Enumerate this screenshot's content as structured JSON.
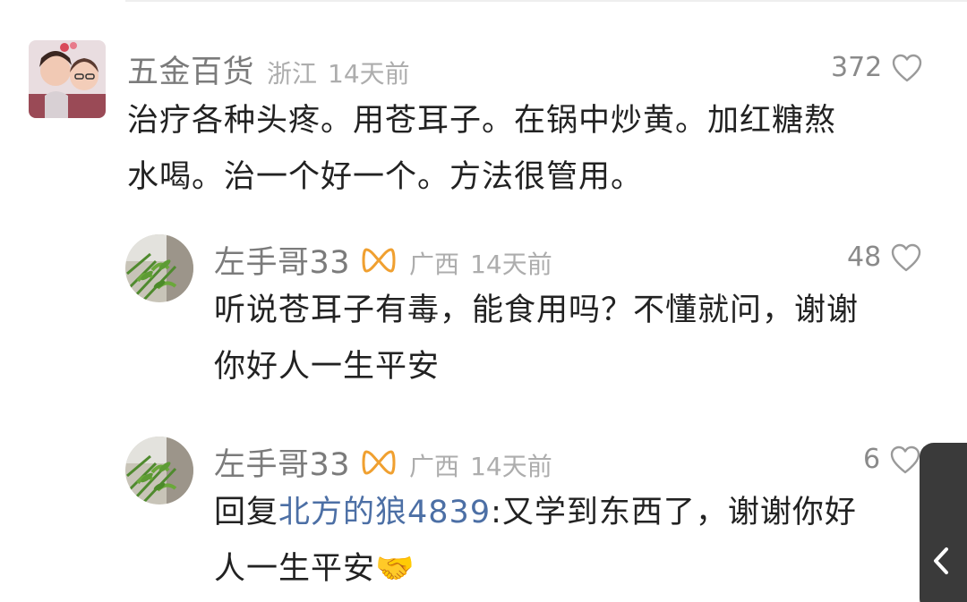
{
  "comments": [
    {
      "username": "五金百货",
      "region": "浙江",
      "time": "14天前",
      "likes": "372",
      "text_line1": "治疗各种头疼。用苍耳子。在锅中炒黄。加红糖熬",
      "text_line2": "水喝。治一个好一个。方法很管用。"
    },
    {
      "username": "左手哥33",
      "region": "广西",
      "time": "14天前",
      "likes": "48",
      "text_line1": "听说苍耳子有毒，能食用吗？不懂就问，谢谢",
      "text_line2": "你好人一生平安"
    },
    {
      "username": "左手哥33",
      "region": "广西",
      "time": "14天前",
      "likes": "6",
      "reply_prefix": "回复",
      "reply_target": "北方的狼4839",
      "text_line1_rest": ":又学到东西了，谢谢你好",
      "text_line2": "人一生平安",
      "emoji": "🤝"
    }
  ],
  "icons": {
    "like": "heart-outline-icon",
    "badge": "infinity-badge-icon",
    "back": "chevron-left-icon"
  },
  "colors": {
    "username": "#7b7b7b",
    "meta": "#adadad",
    "body": "#222222",
    "reply_link": "#4c6fa5",
    "badge": "#f0a030"
  }
}
